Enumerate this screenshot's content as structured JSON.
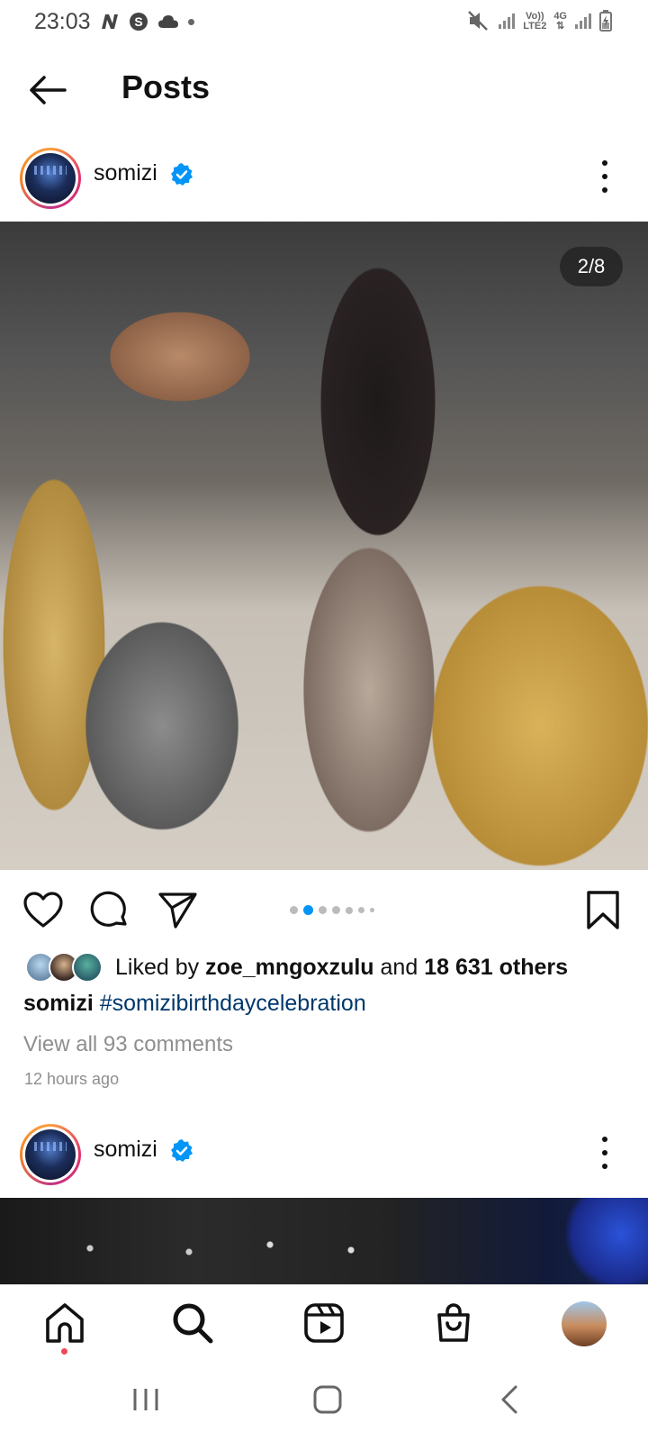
{
  "status_bar": {
    "time": "23:03",
    "notification_icons": [
      "n-logo-icon",
      "s-circle-icon",
      "cloud-icon",
      "dot-icon"
    ],
    "net_label_top": "Vo))",
    "net_label_bottom": "LTE2",
    "net_4g": "4G"
  },
  "header": {
    "back_icon": "arrow-left-icon",
    "title": "Posts"
  },
  "posts": [
    {
      "username": "somizi",
      "verified": true,
      "counter": "2/8",
      "carousel_total": 8,
      "carousel_active": 1,
      "liked_by_prefix": "Liked by ",
      "liked_by_user": "zoe_mngoxzulu",
      "liked_and": " and ",
      "liked_others": "18 631 others",
      "caption_user": "somizi",
      "caption_tag": "#somizibirthdaycelebration",
      "view_comments": "View all 93 comments",
      "time_ago": "12 hours ago"
    },
    {
      "username": "somizi",
      "verified": true
    }
  ],
  "actions": {
    "like_icon": "heart-icon",
    "comment_icon": "comment-icon",
    "share_icon": "send-icon",
    "save_icon": "bookmark-icon"
  },
  "bottom_nav": [
    "home-icon",
    "search-icon",
    "reels-icon",
    "shop-icon",
    "profile-avatar"
  ],
  "system_nav": [
    "recents-icon",
    "home-button-icon",
    "back-chevron-icon"
  ],
  "colors": {
    "accent_blue": "#0095f6",
    "hashtag": "#00376b",
    "muted": "#8e8e8e",
    "notification_red": "#ed4956"
  }
}
